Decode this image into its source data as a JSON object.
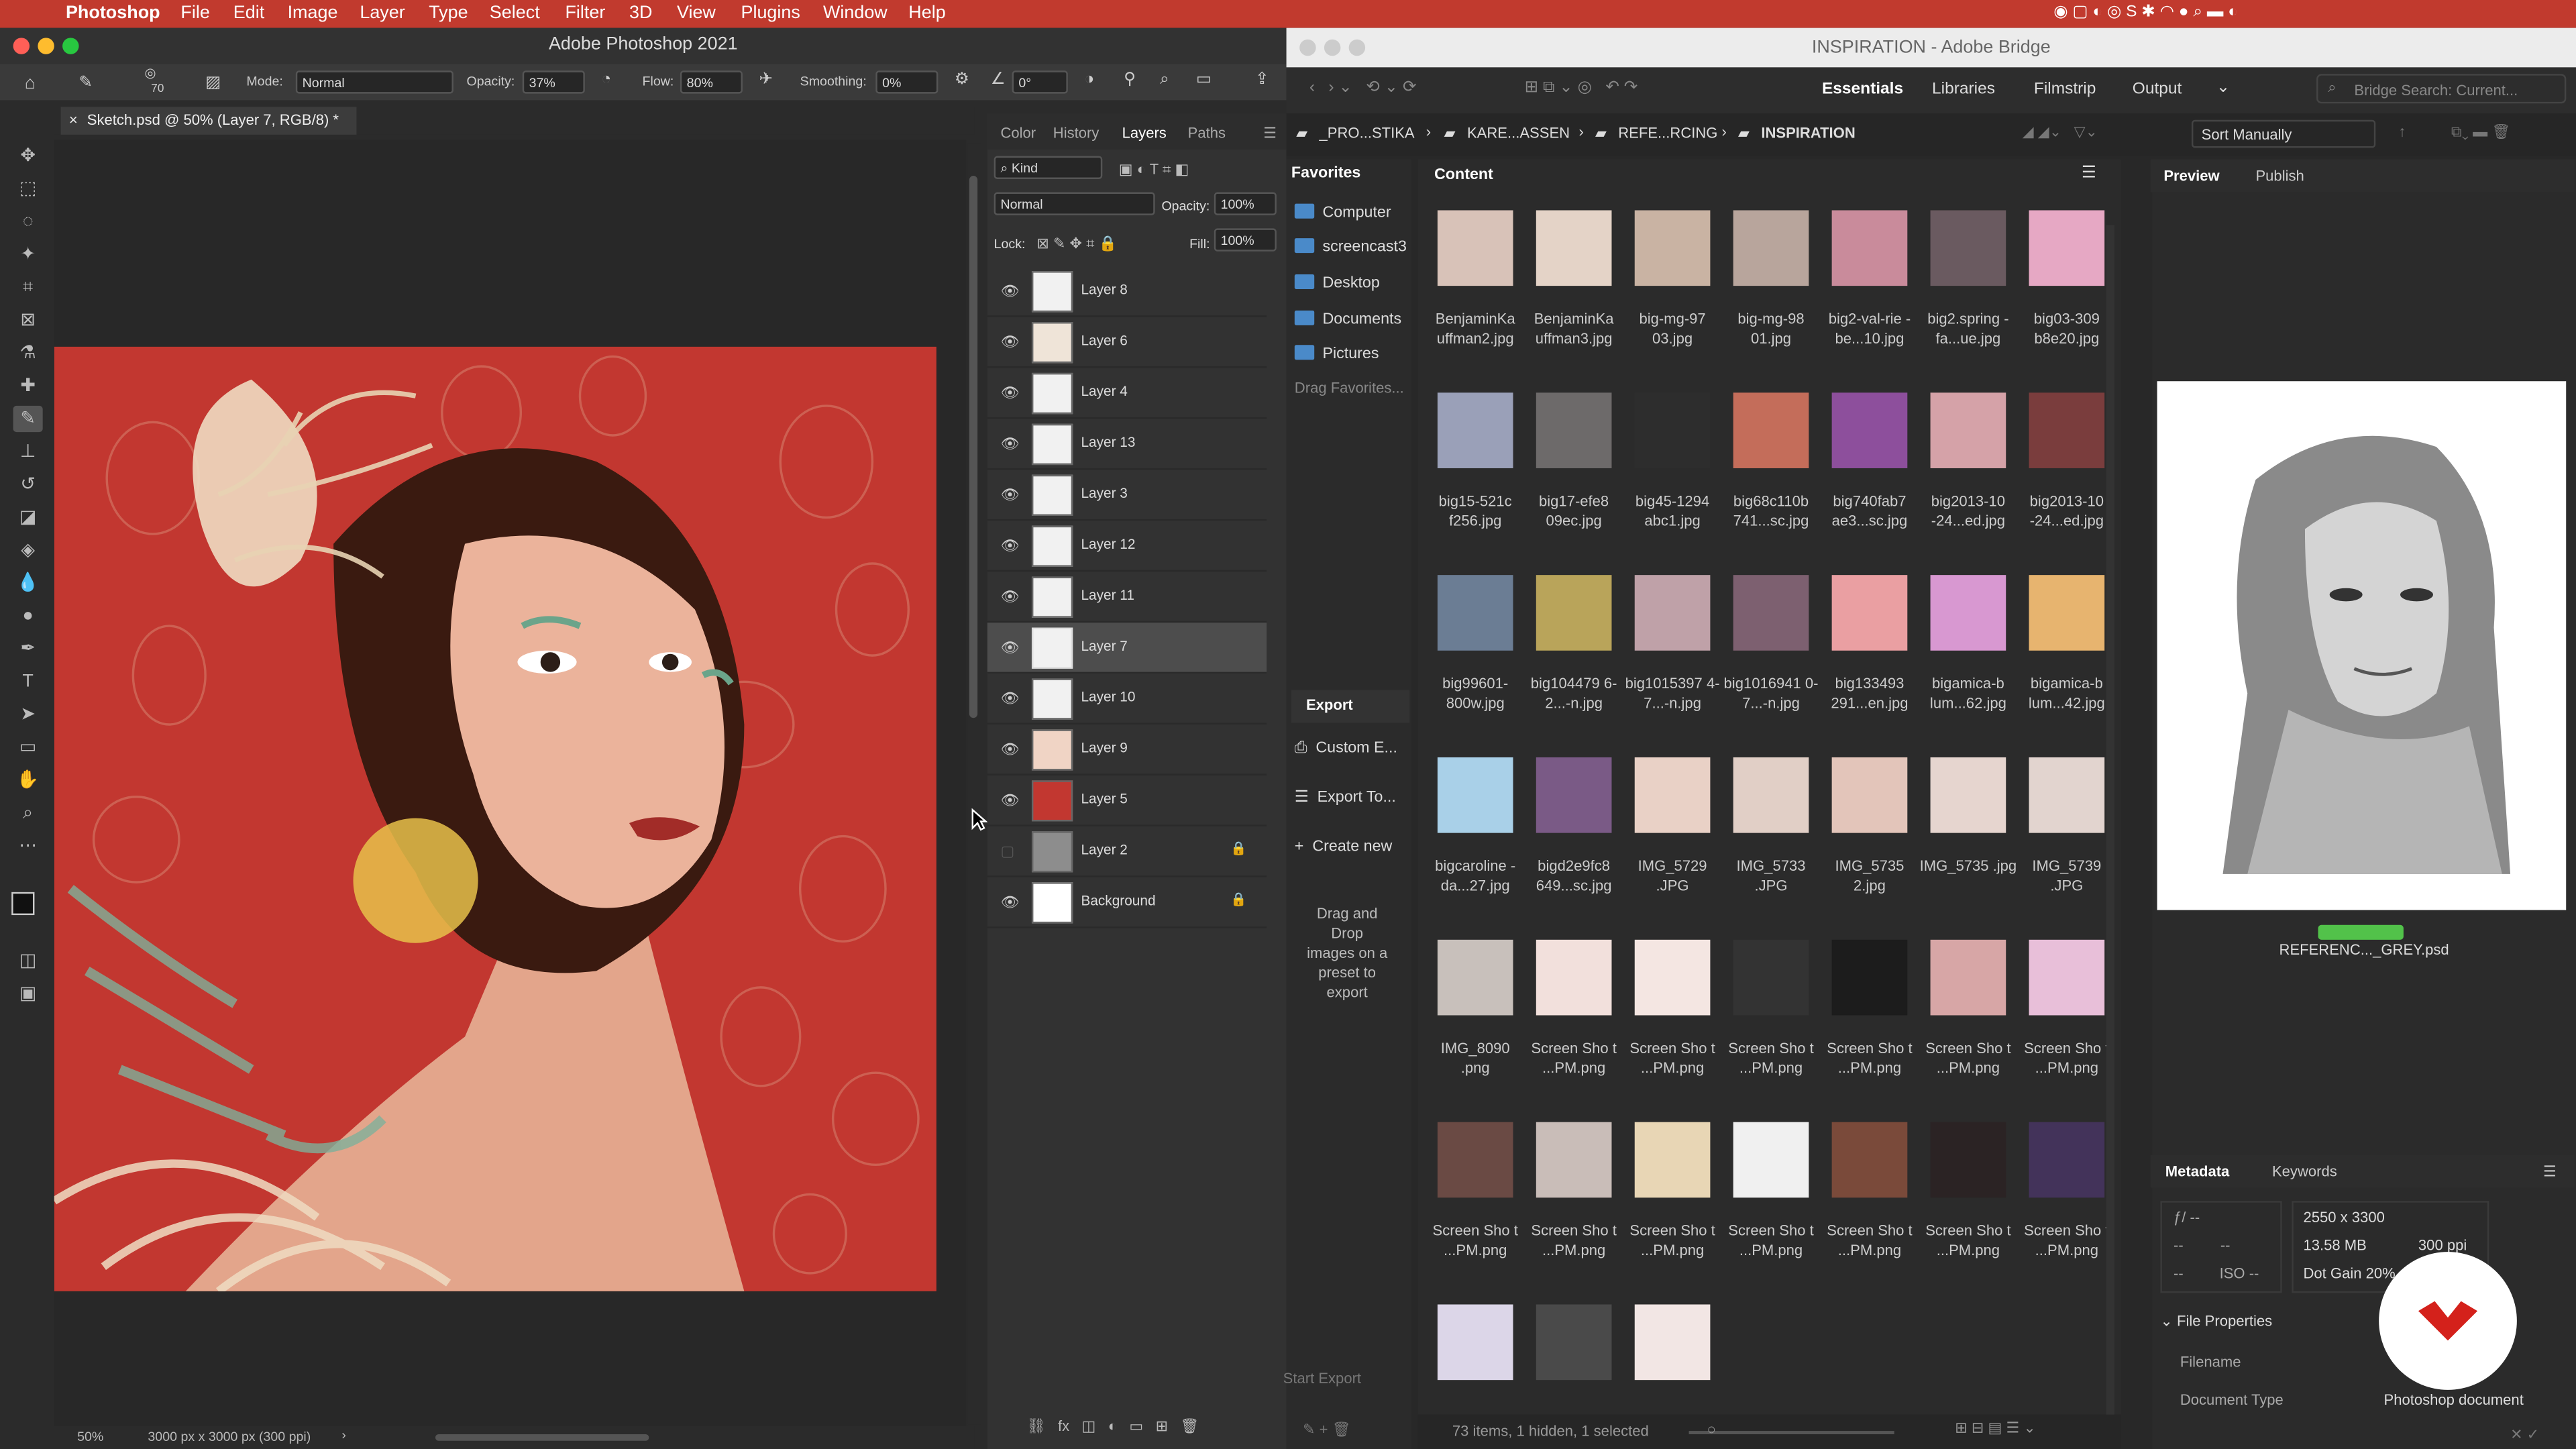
{
  "menubar": {
    "app": "Photoshop",
    "items": [
      "File",
      "Edit",
      "Image",
      "Layer",
      "Type",
      "Select",
      "Filter",
      "3D",
      "View",
      "Plugins",
      "Window",
      "Help"
    ]
  },
  "photoshop": {
    "window_title": "Adobe Photoshop 2021",
    "options": {
      "brush_size": "70",
      "mode_label": "Mode:",
      "mode_value": "Normal",
      "opacity_label": "Opacity:",
      "opacity_value": "37%",
      "flow_label": "Flow:",
      "flow_value": "80%",
      "smoothing_label": "Smoothing:",
      "smoothing_value": "0%",
      "angle_value": "0°"
    },
    "doc_tab": "Sketch.psd @ 50% (Layer 7, RGB/8) *",
    "status": {
      "zoom": "50%",
      "doc_size": "3000 px x 3000 px (300 ppi)"
    },
    "panel_tabs": [
      "Color",
      "History",
      "Layers",
      "Paths"
    ],
    "layers_panel": {
      "filter_kind": "Kind",
      "blend_mode": "Normal",
      "opacity_label": "Opacity:",
      "opacity_value": "100%",
      "lock_label": "Lock:",
      "fill_label": "Fill:",
      "fill_value": "100%",
      "layers": [
        {
          "name": "Layer 8",
          "visible": true
        },
        {
          "name": "Layer 6",
          "visible": true
        },
        {
          "name": "Layer 4",
          "visible": true
        },
        {
          "name": "Layer 13",
          "visible": true
        },
        {
          "name": "Layer 3",
          "visible": true
        },
        {
          "name": "Layer 12",
          "visible": true
        },
        {
          "name": "Layer 11",
          "visible": true
        },
        {
          "name": "Layer 7",
          "visible": true,
          "selected": true
        },
        {
          "name": "Layer 10",
          "visible": true
        },
        {
          "name": "Layer 9",
          "visible": true
        },
        {
          "name": "Layer 5",
          "visible": true
        },
        {
          "name": "Layer 2",
          "visible": false,
          "locked": true
        },
        {
          "name": "Background",
          "visible": true,
          "locked": true
        }
      ]
    }
  },
  "bridge": {
    "window_title": "INSPIRATION - Adobe Bridge",
    "workspaces": [
      "Essentials",
      "Libraries",
      "Filmstrip",
      "Output"
    ],
    "search_placeholder": "Bridge Search: Current...",
    "path": [
      "_PRO...STIKA",
      "KARE...ASSEN",
      "REFE...RCING",
      "INSPIRATION"
    ],
    "sort": "Sort Manually",
    "favorites_title": "Favorites",
    "favorites": [
      "Computer",
      "screencast3",
      "Desktop",
      "Documents",
      "Pictures"
    ],
    "drag_favorites": "Drag Favorites...",
    "export": {
      "title": "Export",
      "items": [
        "Custom E...",
        "Export To...",
        "Create new"
      ],
      "drop_text": "Drag and Drop images on a preset to export",
      "start_label": "Start Export"
    },
    "content_title": "Content",
    "files": [
      "BenjaminKa uffman2.jpg",
      "BenjaminKa uffman3.jpg",
      "big-mg-97 03.jpg",
      "big-mg-98 01.jpg",
      "big2-val-rie -be...10.jpg",
      "big2.spring -fa...ue.jpg",
      "big03-309 b8e20.jpg",
      "big15-521c f256.jpg",
      "big17-efe8 09ec.jpg",
      "big45-1294 abc1.jpg",
      "big68c110b 741...sc.jpg",
      "big740fab7 ae3...sc.jpg",
      "big2013-10 -24...ed.jpg",
      "big2013-10 -24...ed.jpg",
      "big99601- 800w.jpg",
      "big104479 6-2...-n.jpg",
      "big1015397 4-7...-n.jpg",
      "big1016941 0-7...-n.jpg",
      "big133493 291...en.jpg",
      "bigamica-b lum...62.jpg",
      "bigamica-b lum...42.jpg",
      "bigcaroline -da...27.jpg",
      "bigd2e9fc8 649...sc.jpg",
      "IMG_5729 .JPG",
      "IMG_5733 .JPG",
      "IMG_5735 2.jpg",
      "IMG_5735 .jpg",
      "IMG_5739 .JPG",
      "IMG_8090 .png",
      "Screen Sho t ...PM.png",
      "Screen Sho t ...PM.png",
      "Screen Sho t ...PM.png",
      "Screen Sho t ...PM.png",
      "Screen Sho t ...PM.png",
      "Screen Sho t ...PM.png",
      "Screen Sho t ...PM.png",
      "Screen Sho t ...PM.png",
      "Screen Sho t ...PM.png",
      "Screen Sho t ...PM.png",
      "Screen Sho t ...PM.png",
      "Screen Sho t ...PM.png",
      "Screen Sho t ...PM.png"
    ],
    "status": "73 items, 1 hidden, 1 selected",
    "preview_tabs": [
      "Preview",
      "Publish"
    ],
    "preview_filename": "REFERENC..._GREY.psd",
    "metadata_tabs": [
      "Metadata",
      "Keywords"
    ],
    "metadata": {
      "fstop": "ƒ/ --",
      "dims": "2550 x 3300",
      "size": "13.58 MB",
      "ppi": "300 ppi",
      "iso": "ISO --",
      "dotgain": "Dot Gain 20%"
    },
    "file_properties": "File Properties",
    "filename_label": "Filename",
    "doctype_label": "Document Type",
    "doctype_value": "Photoshop document"
  },
  "colors": {
    "menubar": "#c13a2e",
    "canvas_red": "#c23730",
    "accent": "#52c24a"
  }
}
